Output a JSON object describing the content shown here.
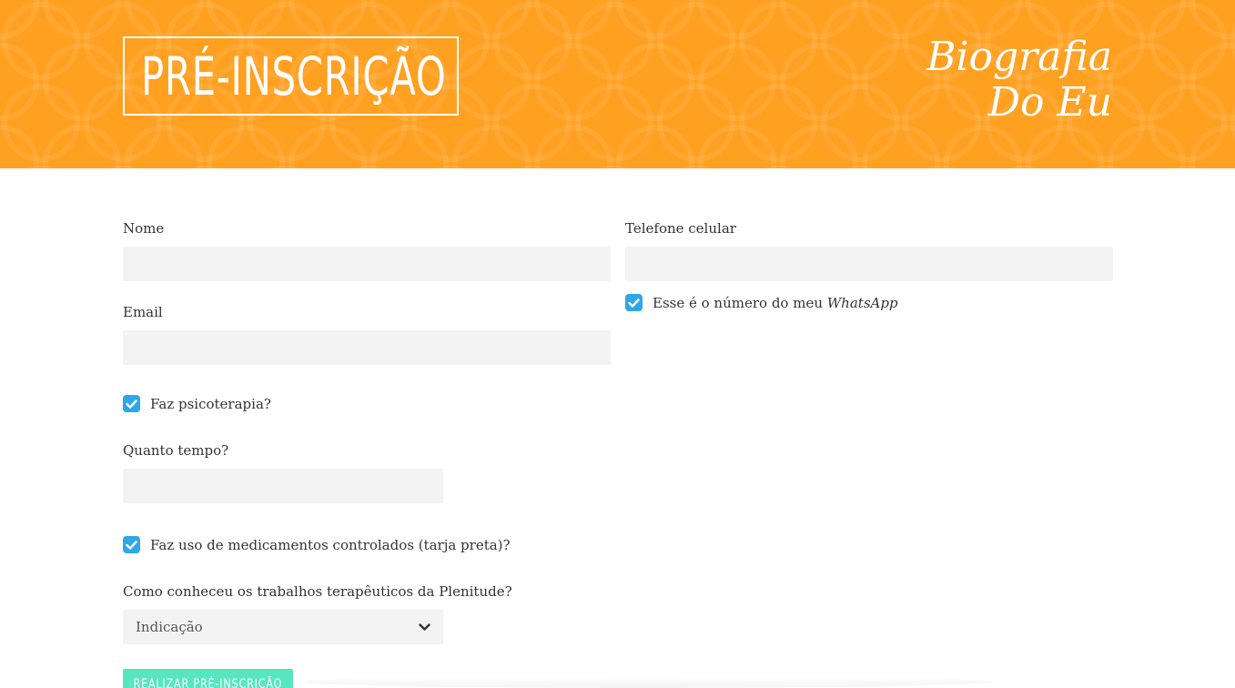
{
  "header": {
    "title": "PRÉ-INSCRIÇÃO",
    "brand_line1": "Biografia",
    "brand_line2": "Do Eu",
    "background_color": "#ffa020"
  },
  "form": {
    "nome_label": "Nome",
    "nome_value": "",
    "email_label": "Email",
    "email_value": "",
    "telefone_label": "Telefone celular",
    "telefone_value": "",
    "whatsapp_label": "Esse é o número do meu ",
    "whatsapp_label_emphasis": "WhatsApp",
    "whatsapp_checked": true,
    "psicoterapia_label": "Faz psicoterapia?",
    "psicoterapia_checked": true,
    "quanto_tempo_label": "Quanto tempo?",
    "quanto_tempo_value": "",
    "medicamentos_label": "Faz uso de medicamentos controlados (tarja preta)?",
    "medicamentos_checked": true,
    "como_conheceu_label": "Como conheceu os trabalhos terapêuticos da Plenitude?",
    "como_conheceu_selected": "Indicação",
    "submit_label": "REALIZAR PRÉ-INSCRIÇÃO"
  },
  "colors": {
    "accent_orange": "#ffa020",
    "checkbox_blue": "#2ea7e8",
    "submit_green": "#57e6c0",
    "input_bg": "#f3f3f3"
  },
  "icons": {
    "checkbox": "check-icon",
    "select": "chevron-down-icon"
  }
}
